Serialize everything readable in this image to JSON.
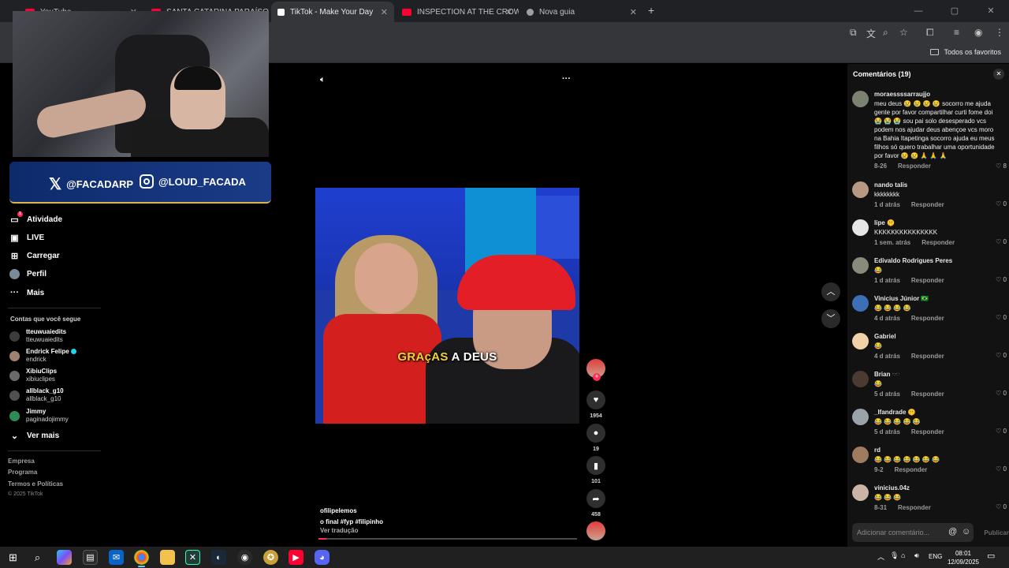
{
  "browser": {
    "tabs": [
      {
        "label": "YouTube",
        "fav_color": "#ff0033"
      },
      {
        "label": "SANTA CATARINA PARAÍSO DA",
        "fav_color": "#ff0033"
      },
      {
        "label": "TikTok - Make Your Day",
        "fav_color": "#ffffff"
      },
      {
        "label": "INSPECTION AT THE CROWDED",
        "fav_color": "#ff0033"
      },
      {
        "label": "Nova guia",
        "fav_color": "#9aa0a6"
      }
    ],
    "new_tab": "+",
    "bookmarks_folder": "Todos os favoritos"
  },
  "stream_overlay": {
    "x_handle": "@FACADARP",
    "ig_handle": "@LOUD_FACADA"
  },
  "sidebar": {
    "nav": [
      {
        "label": "Atividade",
        "icon": "activity-icon"
      },
      {
        "label": "LIVE",
        "icon": "live-icon"
      },
      {
        "label": "Carregar",
        "icon": "upload-icon"
      },
      {
        "label": "Perfil",
        "icon": "profile-icon"
      },
      {
        "label": "Mais",
        "icon": "more-icon"
      }
    ],
    "activity_badge": "1",
    "following_title": "Contas que você segue",
    "following": [
      {
        "name": "tteuwuaiedits",
        "handle": "tteuwuaiedits",
        "verified": false
      },
      {
        "name": "Endrick Felipe",
        "handle": "endrick",
        "verified": true
      },
      {
        "name": "XibiuClips",
        "handle": "xibiuclipes",
        "verified": false
      },
      {
        "name": "allblack_g10",
        "handle": "allblack_g10",
        "verified": false
      },
      {
        "name": "Jimmy",
        "handle": "paginadojimmy",
        "verified": false
      }
    ],
    "see_more": "Ver mais",
    "footer": [
      "Empresa",
      "Programa",
      "Termos e Políticas"
    ],
    "copyright": "© 2025 TikTok"
  },
  "video": {
    "caption_part1": "GRAçAS",
    "caption_part2": " A DEUS",
    "author": "ofilipelemos",
    "description": "o final #fyp  #filipinho",
    "translate": "Ver tradução",
    "progress": 0.03,
    "likes": "1954",
    "comments": "19",
    "saves": "101",
    "shares": "458"
  },
  "comments_panel": {
    "title": "Comentários (19)",
    "reply_label": "Responder",
    "input_placeholder": "Adicionar comentário...",
    "publish_label": "Publicar",
    "items": [
      {
        "user": "moraessssarraujjo",
        "text": "meu deus 😢 😢 😢 😢 socorro me ajuda gente por favor compartilhar curti fome doi😭 😭 😭 sou pai solo desesperado vcs podem nos ajudar deus abençoe vcs moro na Bahia Itapetinga socorro ajuda eu meus filhos só quero trabalhar uma oportunidade por favor 😢 😢 🙏 🙏 🙏",
        "date": "8-26",
        "likes": "8"
      },
      {
        "user": "nando talis",
        "text": "kkkkkkkk",
        "date": "1 d atrás",
        "likes": "0"
      },
      {
        "user": "lipe 🤫",
        "text": "KKKKKKKKKKKKKKK",
        "date": "1 sem. atrás",
        "likes": "0"
      },
      {
        "user": "Edivaldo Rodrigues Peres",
        "text": "😂",
        "date": "1 d atrás",
        "likes": "0"
      },
      {
        "user": "Vinicius Júnior 🇧🇷",
        "text": "😂 😂 😂 😂",
        "date": "4 d atrás",
        "likes": "0"
      },
      {
        "user": "Gabriel",
        "text": "😂",
        "date": "4 d atrás",
        "likes": "0"
      },
      {
        "user": "Brian 🕶️",
        "text": "😂",
        "date": "5 d atrás",
        "likes": "0"
      },
      {
        "user": "_lfandrade 🤫",
        "text": "😂 😂 😂 😂 😂",
        "date": "5 d atrás",
        "likes": "0"
      },
      {
        "user": "rd",
        "text": "😂 😂 😂 😂 😂 😂 😂",
        "date": "9-2",
        "likes": "0"
      },
      {
        "user": "vinicius.04z",
        "text": "😂 😂 😂",
        "date": "8-31",
        "likes": "0"
      }
    ]
  },
  "taskbar": {
    "language": "ENG",
    "time": "08:01",
    "date": "12/09/2025"
  }
}
